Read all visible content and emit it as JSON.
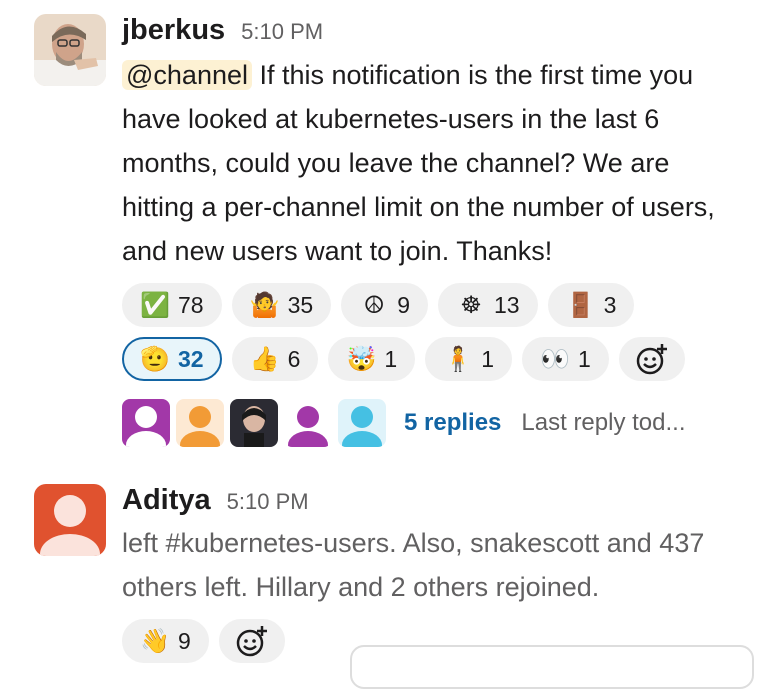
{
  "message1": {
    "author": "jberkus",
    "time": "5:10 PM",
    "mention": "@channel",
    "text": " If this notification is the first time you have looked at kubernetes-users in the last 6 months, could you leave the channel?  We are hitting a per-channel limit on the number of users, and new users want to join.  Thanks!",
    "reactions": [
      {
        "icon": "check-mark-icon",
        "glyph": "✅",
        "count": "78"
      },
      {
        "icon": "shrug-bird-icon",
        "glyph": "🤷",
        "count": "35"
      },
      {
        "icon": "peace-sign-icon",
        "glyph": "☮",
        "count": "9"
      },
      {
        "icon": "kubernetes-icon",
        "glyph": "☸",
        "count": "13"
      },
      {
        "icon": "door-icon",
        "glyph": "🚪",
        "count": "3"
      },
      {
        "icon": "saluting-face-icon",
        "glyph": "🫡",
        "count": "32",
        "selected": true
      },
      {
        "icon": "thumbs-up-icon",
        "glyph": "👍",
        "count": "6"
      },
      {
        "icon": "exploding-head-icon",
        "glyph": "🤯",
        "count": "1"
      },
      {
        "icon": "person-in-green-icon",
        "glyph": "🧍",
        "count": "1"
      },
      {
        "icon": "eyes-icon",
        "glyph": "👀",
        "count": "1"
      }
    ],
    "thread": {
      "replies": "5 replies",
      "last_reply": "Last reply tod..."
    }
  },
  "message2": {
    "author": "Aditya",
    "time": "5:10 PM",
    "text": "left #kubernetes-users. Also, snakescott and 437 others left. Hillary and 2 others rejoined.",
    "reactions": [
      {
        "icon": "waving-hand-icon",
        "glyph": "👋",
        "count": "9"
      }
    ]
  },
  "colors": {
    "link": "#1264a3",
    "mention_bg": "#fdf1d3",
    "pill_bg": "#f0f0f0",
    "aditya_avatar": "#e0522f"
  }
}
